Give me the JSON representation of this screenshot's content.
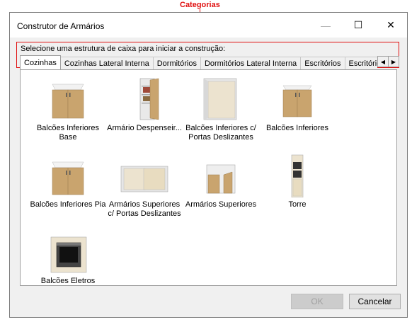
{
  "annotation": {
    "label": "Categorias"
  },
  "window": {
    "title": "Construtor de Armários",
    "controls": {
      "minimize": "—",
      "maximize": "☐",
      "close": "✕"
    }
  },
  "prompt": "Selecione uma estrutura de caixa para iniciar a construção:",
  "tabs": [
    {
      "label": "Cozinhas",
      "active": true
    },
    {
      "label": "Cozinhas Lateral Interna"
    },
    {
      "label": "Dormitórios"
    },
    {
      "label": "Dormitórios Lateral Interna"
    },
    {
      "label": "Escritórios"
    },
    {
      "label": "Escritórios L"
    }
  ],
  "tab_scroll": {
    "left": "◀",
    "right": "▶"
  },
  "items": [
    {
      "label": "Balcões Inferiores Base",
      "icon": "base-cabinet-icon"
    },
    {
      "label": "Armário Despenseir...",
      "icon": "pantry-cabinet-icon"
    },
    {
      "label": "Balcões Inferiores c/ Portas Deslizantes",
      "icon": "sliding-door-cabinet-icon"
    },
    {
      "label": "Balcões Inferiores",
      "icon": "lower-cabinet-icon"
    },
    {
      "label": "Balcões Inferiores Pia",
      "icon": "sink-cabinet-icon"
    },
    {
      "label": "Armários Superiores c/ Portas Deslizantes",
      "icon": "upper-sliding-cabinet-icon"
    },
    {
      "label": "Armários Superiores",
      "icon": "upper-cabinet-icon"
    },
    {
      "label": "Torre",
      "icon": "tower-cabinet-icon"
    },
    {
      "label": "Balcões Eletros",
      "icon": "appliance-cabinet-icon"
    }
  ],
  "buttons": {
    "ok": "OK",
    "cancel": "Cancelar"
  },
  "colors": {
    "annotation": "#e01010",
    "wood": "#c9a46e",
    "wood_light": "#e8dcc0",
    "carcass": "#e9e9e9"
  }
}
